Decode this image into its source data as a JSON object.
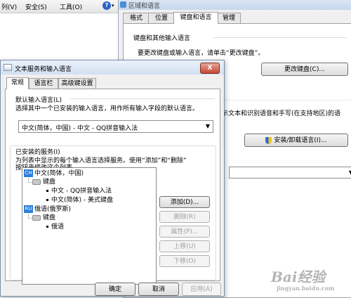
{
  "menu": {
    "items": [
      "列(V)",
      "安全(S)",
      "工具(O)"
    ],
    "help_icon": "question-icon"
  },
  "region_dialog": {
    "title": "区域和语言",
    "tabs": [
      "格式",
      "位置",
      "键盘和语言",
      "管理"
    ],
    "active_tab": "键盘和语言",
    "group_title": "键盘和其他输入语言",
    "description": "要更改键盘或输入语言，请单击“更改键盘”。",
    "change_keyboard_button": "更改键盘(C)...",
    "display_text": "示文本和识别语音和手写(在支持地区)的语",
    "install_button": "安装/卸载语言(I)..."
  },
  "dialog": {
    "title": "文本服务和输入语言",
    "close_label": "X",
    "tabs": [
      "常规",
      "语言栏",
      "高级键设置"
    ],
    "active_tab": "常规",
    "default_group_title": "默认输入语言(L)",
    "default_group_desc": "选择其中一个已安装的输入语言，用作所有输入字段的默认语言。",
    "default_value": "中文(简体，中国) - 中文 - QQ拼音输入法",
    "installed_group_title": "已安装的服务(I)",
    "installed_desc_line1": "为列表中显示的每个输入语言选择服务。使用“添加”和“删除”",
    "installed_desc_line2": "按钮来修改这个列表。",
    "tree": {
      "lang1_badge": "CH",
      "lang1_name": "中文(简体，中国)",
      "lang1_keyboard": "键盘",
      "lang1_ime1": "中文 - QQ拼音输入法",
      "lang1_ime2": "中文(简体) - 美式键盘",
      "lang2_badge": "RU",
      "lang2_name": "俄语(俄罗斯)",
      "lang2_keyboard": "键盘",
      "lang2_ime1": "俄语"
    },
    "side_buttons": {
      "add": "添加(D)...",
      "remove": "删除(R)",
      "properties": "属性(P)...",
      "move_up": "上移(U)",
      "move_down": "下移(O)"
    },
    "bottom_buttons": {
      "ok": "确定",
      "cancel": "取消",
      "apply": "应用(A)"
    }
  },
  "watermark": {
    "text": "Bai经验",
    "sub": "jingyan.baidu.com"
  },
  "colors": {
    "lang_badge": "#2b7fd8",
    "close_button": "#c64933"
  }
}
